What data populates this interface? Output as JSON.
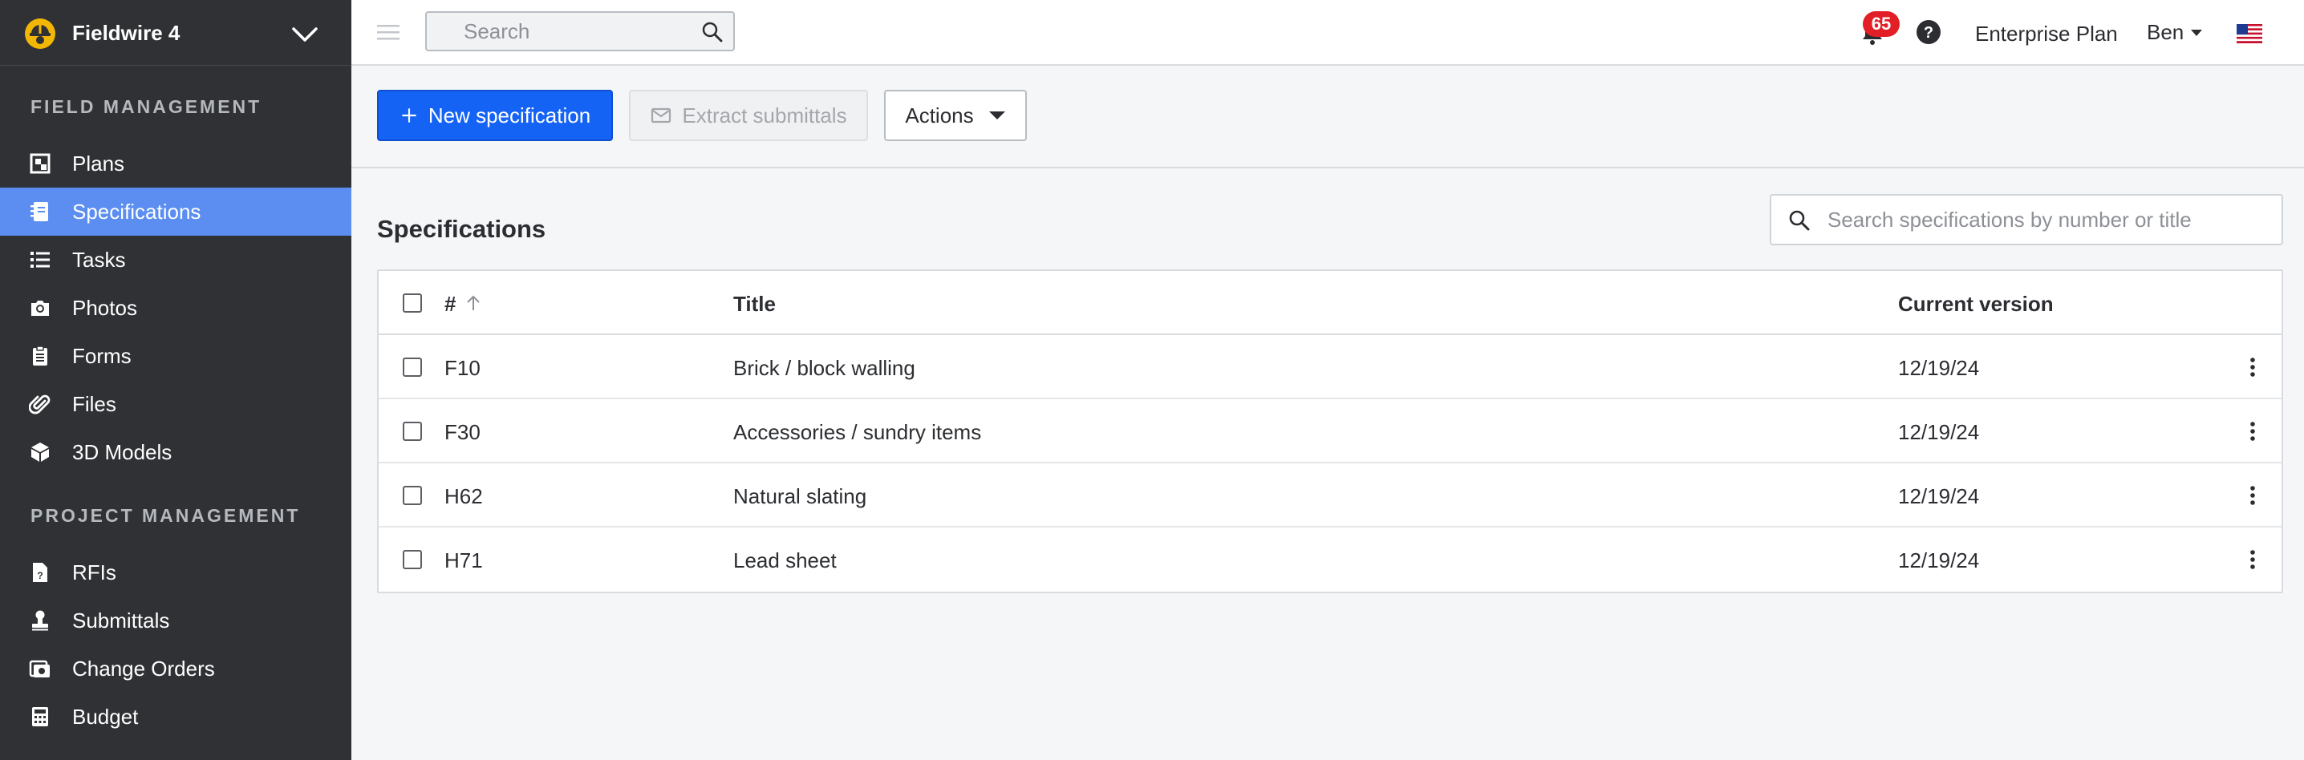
{
  "project": {
    "name": "Fieldwire 4"
  },
  "sidebar": {
    "sections": [
      {
        "title": "FIELD MANAGEMENT"
      },
      {
        "title": "PROJECT MANAGEMENT"
      }
    ],
    "items": [
      {
        "label": "Plans",
        "icon": "plans-icon"
      },
      {
        "label": "Specifications",
        "icon": "specifications-icon",
        "active": true
      },
      {
        "label": "Tasks",
        "icon": "tasks-icon"
      },
      {
        "label": "Photos",
        "icon": "camera-icon"
      },
      {
        "label": "Forms",
        "icon": "clipboard-icon"
      },
      {
        "label": "Files",
        "icon": "paperclip-icon"
      },
      {
        "label": "3D Models",
        "icon": "cube-icon"
      },
      {
        "label": "RFIs",
        "icon": "rfi-document-icon"
      },
      {
        "label": "Submittals",
        "icon": "stamp-icon"
      },
      {
        "label": "Change Orders",
        "icon": "change-orders-icon"
      },
      {
        "label": "Budget",
        "icon": "calculator-icon"
      }
    ]
  },
  "header": {
    "search_placeholder": "Search",
    "notifications_count": "65",
    "plan": "Enterprise Plan",
    "user": "Ben"
  },
  "toolbar": {
    "new_label": "New specification",
    "extract_label": "Extract submittals",
    "actions_label": "Actions"
  },
  "main": {
    "title": "Specifications",
    "search_placeholder": "Search specifications by number or title"
  },
  "table": {
    "columns": {
      "number": "#",
      "title": "Title",
      "version": "Current version"
    },
    "rows": [
      {
        "number": "F10",
        "title": "Brick / block walling",
        "version": "12/19/24"
      },
      {
        "number": "F30",
        "title": "Accessories / sundry items",
        "version": "12/19/24"
      },
      {
        "number": "H62",
        "title": "Natural slating",
        "version": "12/19/24"
      },
      {
        "number": "H71",
        "title": "Lead sheet",
        "version": "12/19/24"
      }
    ]
  },
  "colors": {
    "sidebar_bg": "#2f3134",
    "active_item": "#5b8ef0",
    "primary": "#1463f5",
    "badge": "#e21f26",
    "logo": "#f2b705"
  }
}
